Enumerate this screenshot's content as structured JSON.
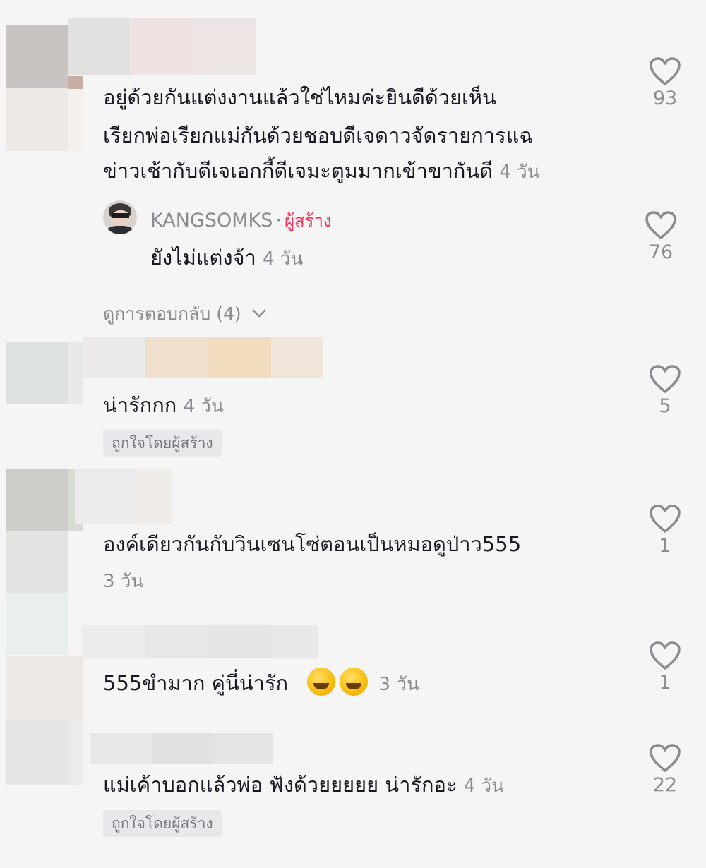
{
  "comments": [
    {
      "text_lines": [
        "อยู่ด้วยกันแต่งงานแล้วใช่ไหมค่ะยินดีด้วยเห็น",
        "เรียกพ่อเรียกแม่กันด้วยชอบดีเจดาวจัดรายการแฉ",
        "ข่าวเช้ากับดีเจเอกกี้ดีเจมะตูมมากเข้าขากันดี"
      ],
      "time": "4 วัน",
      "likes": "93",
      "reply": {
        "author": "KANGSOMKS",
        "separator": "·",
        "creator_label": "ผู้สร้าง",
        "text": "ยังไม่แต่งจ้า",
        "time": "4 วัน",
        "likes": "76"
      },
      "view_replies": "ดูการตอบกลับ (4)"
    },
    {
      "text": "น่ารักกก",
      "time": "4 วัน",
      "likes": "5",
      "badge": "ถูกใจโดยผู้สร้าง"
    },
    {
      "text": "องค์เดียวกันกับวินเซนโซ่ตอนเป็นหมอดูป่าว555",
      "time": "3 วัน",
      "likes": "1"
    },
    {
      "text": "555ขำมาก  คู่นี่น่ารัก",
      "emoji": "rolling-on-floor-laughing-emoji",
      "time": "3 วัน",
      "likes": "1"
    },
    {
      "text": "แม่เค้าบอกแล้วพ่อ ฟังด้วยยยยย น่ารักอะ",
      "time": "4 วัน",
      "likes": "22",
      "badge": "ถูกใจโดยผู้สร้าง"
    }
  ],
  "colors": {
    "background": "#f6f5f6",
    "text": "#161823",
    "secondary": "#8a8b91",
    "creator": "#fe2c55",
    "badge_bg": "#e8e7ea"
  }
}
